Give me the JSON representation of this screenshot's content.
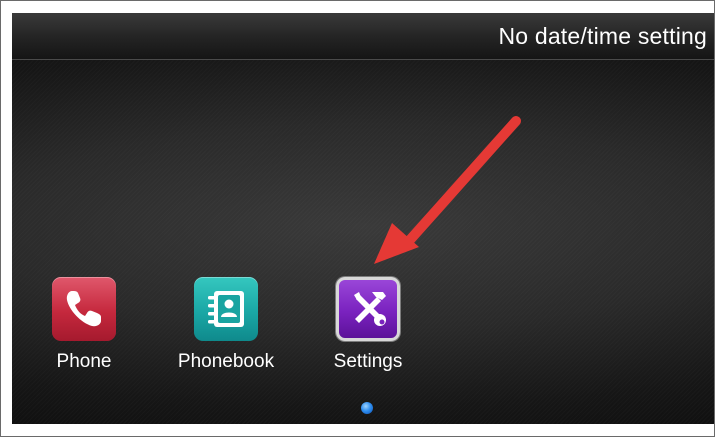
{
  "status_bar": {
    "datetime_text": "No date/time setting"
  },
  "apps": [
    {
      "label": "Phone",
      "icon": "phone-icon",
      "color": "#c5283d"
    },
    {
      "label": "Phonebook",
      "icon": "contacts-book-icon",
      "color": "#1aa7a5"
    },
    {
      "label": "Settings",
      "icon": "tools-icon",
      "color": "#7a22bf",
      "selected": true
    }
  ],
  "pager": {
    "pages": 1,
    "current": 1,
    "dot_color": "#2f8ff0"
  },
  "annotation": {
    "type": "arrow",
    "color": "#e53935",
    "points_to": "Settings"
  }
}
